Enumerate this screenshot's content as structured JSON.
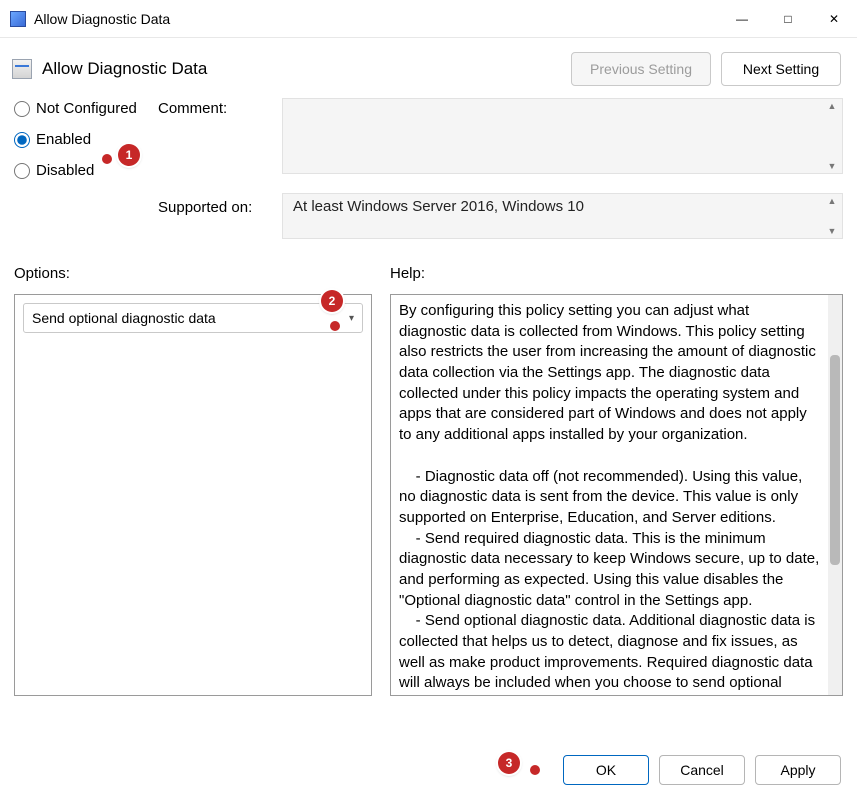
{
  "window": {
    "title": "Allow Diagnostic Data"
  },
  "header": {
    "title": "Allow Diagnostic Data",
    "prev": "Previous Setting",
    "next": "Next Setting"
  },
  "state": {
    "not_configured": "Not Configured",
    "enabled": "Enabled",
    "disabled": "Disabled",
    "selected": "enabled"
  },
  "labels": {
    "comment": "Comment:",
    "supported": "Supported on:",
    "options": "Options:",
    "help": "Help:"
  },
  "supported_text": "At least Windows Server 2016, Windows 10",
  "options": {
    "dropdown_value": "Send optional diagnostic data"
  },
  "help_text": "By configuring this policy setting you can adjust what diagnostic data is collected from Windows. This policy setting also restricts the user from increasing the amount of diagnostic data collection via the Settings app. The diagnostic data collected under this policy impacts the operating system and apps that are considered part of Windows and does not apply to any additional apps installed by your organization.\n\n    - Diagnostic data off (not recommended). Using this value, no diagnostic data is sent from the device. This value is only supported on Enterprise, Education, and Server editions.\n    - Send required diagnostic data. This is the minimum diagnostic data necessary to keep Windows secure, up to date, and performing as expected. Using this value disables the \"Optional diagnostic data\" control in the Settings app.\n    - Send optional diagnostic data. Additional diagnostic data is collected that helps us to detect, diagnose and fix issues, as well as make product improvements. Required diagnostic data will always be included when you choose to send optional diagnostic data. Optional diagnostic data can also include diagnostic log files and",
  "buttons": {
    "ok": "OK",
    "cancel": "Cancel",
    "apply": "Apply"
  },
  "annotations": {
    "a1": "1",
    "a2": "2",
    "a3": "3"
  }
}
